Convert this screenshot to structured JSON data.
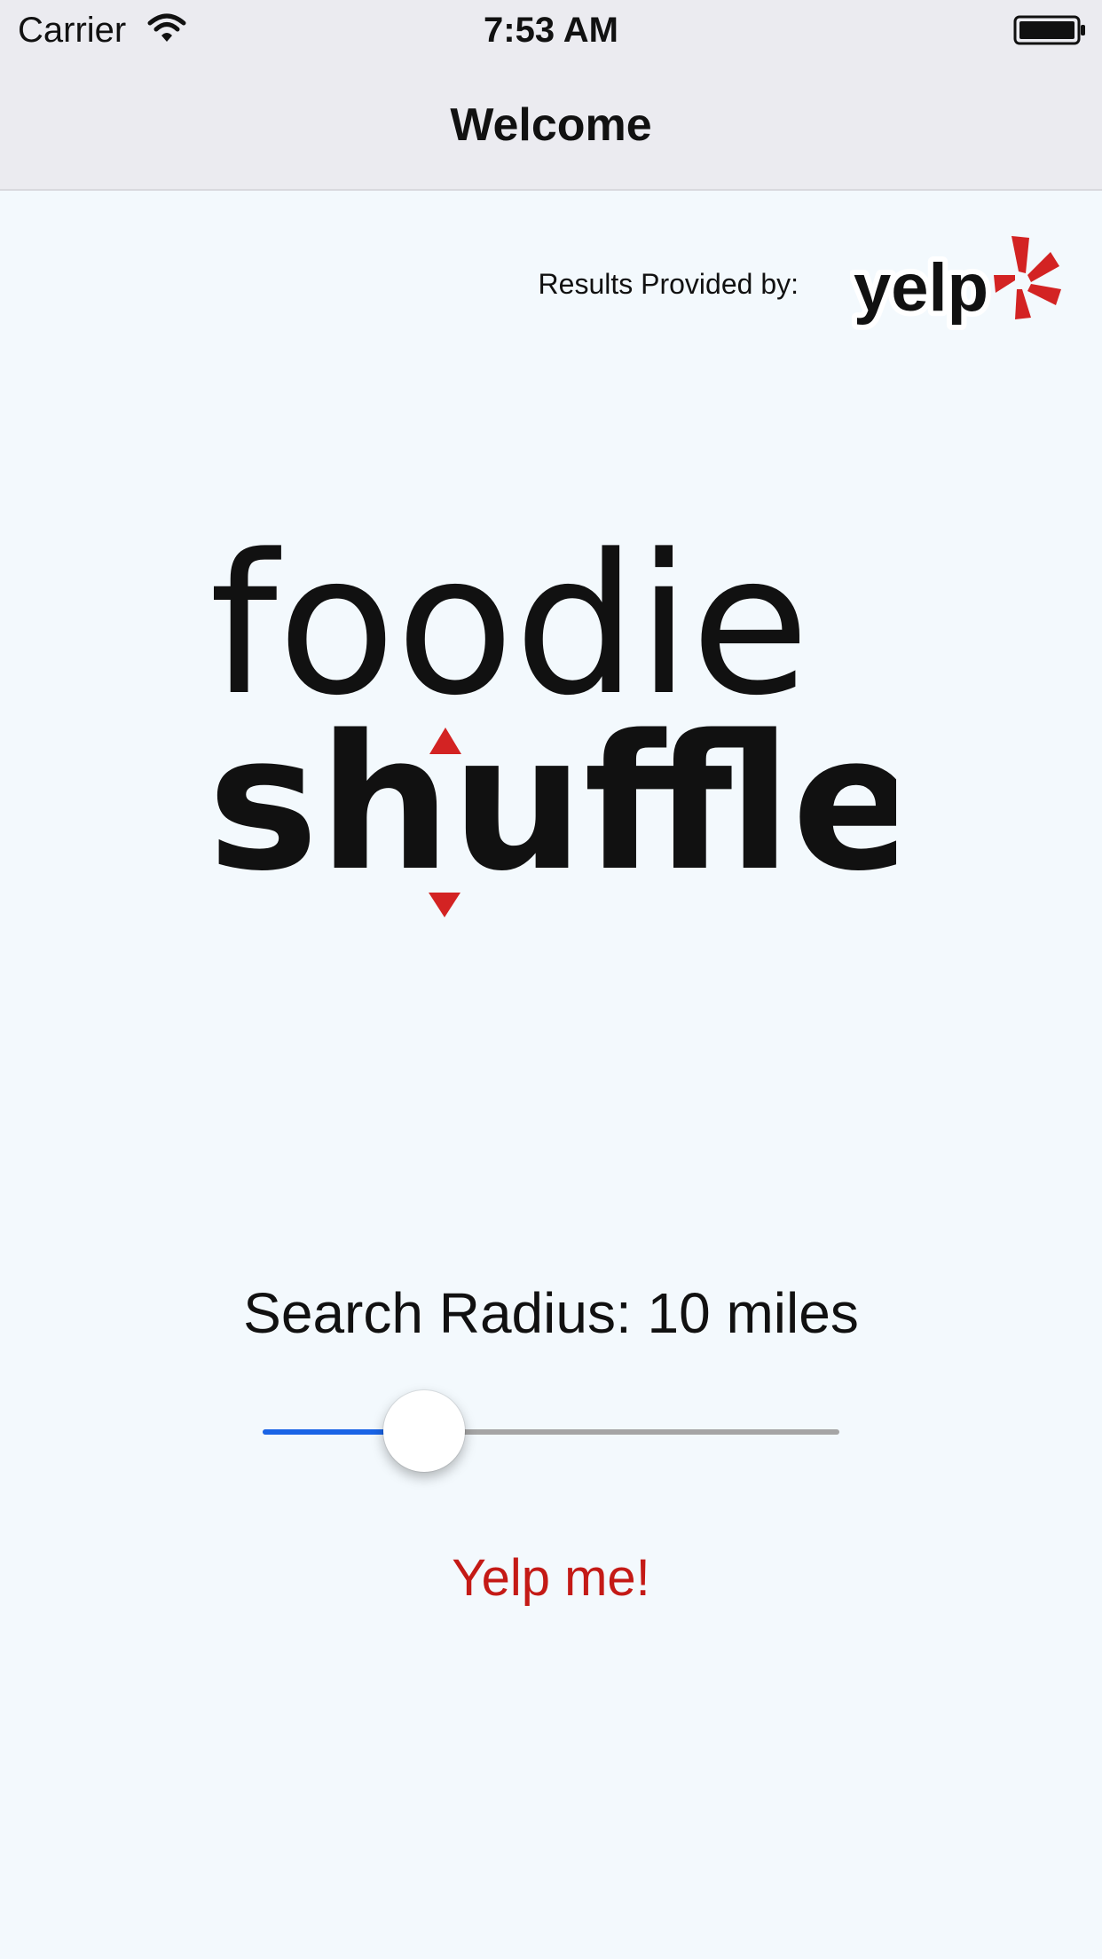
{
  "status_bar": {
    "carrier": "Carrier",
    "time": "7:53 AM",
    "wifi_icon": "wifi-icon",
    "battery_icon": "battery-full-icon"
  },
  "nav_bar": {
    "title": "Welcome"
  },
  "attribution": {
    "label": "Results Provided by:",
    "logo_text": "yelp",
    "logo_icon": "yelp-burst-icon",
    "logo_color": "#d32323"
  },
  "app_logo": {
    "line1": "foodie",
    "line2": "shuffle",
    "arrow_color": "#d32323",
    "arrow_icon": "up-down-arrows-icon"
  },
  "search": {
    "radius_label": "Search Radius: 10 miles",
    "slider_value": 0.28,
    "fill_color": "#1a64e6",
    "track_color": "#a5a5a5"
  },
  "actions": {
    "primary_label": "Yelp me!",
    "primary_color": "#c41a16"
  }
}
